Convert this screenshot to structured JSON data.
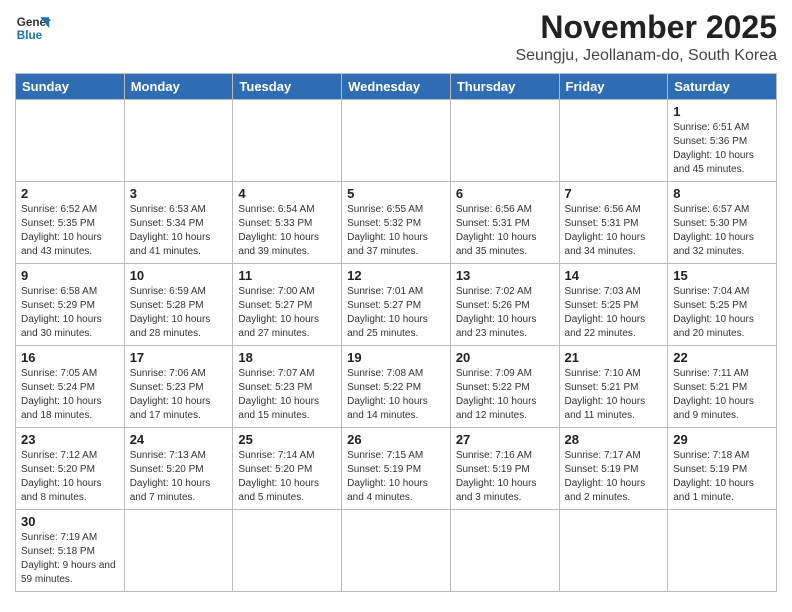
{
  "header": {
    "logo_line1": "General",
    "logo_line2": "Blue",
    "month": "November 2025",
    "location": "Seungju, Jeollanam-do, South Korea"
  },
  "days_of_week": [
    "Sunday",
    "Monday",
    "Tuesday",
    "Wednesday",
    "Thursday",
    "Friday",
    "Saturday"
  ],
  "weeks": [
    [
      {
        "day": "",
        "info": ""
      },
      {
        "day": "",
        "info": ""
      },
      {
        "day": "",
        "info": ""
      },
      {
        "day": "",
        "info": ""
      },
      {
        "day": "",
        "info": ""
      },
      {
        "day": "",
        "info": ""
      },
      {
        "day": "1",
        "info": "Sunrise: 6:51 AM\nSunset: 5:36 PM\nDaylight: 10 hours and 45 minutes."
      }
    ],
    [
      {
        "day": "2",
        "info": "Sunrise: 6:52 AM\nSunset: 5:35 PM\nDaylight: 10 hours and 43 minutes."
      },
      {
        "day": "3",
        "info": "Sunrise: 6:53 AM\nSunset: 5:34 PM\nDaylight: 10 hours and 41 minutes."
      },
      {
        "day": "4",
        "info": "Sunrise: 6:54 AM\nSunset: 5:33 PM\nDaylight: 10 hours and 39 minutes."
      },
      {
        "day": "5",
        "info": "Sunrise: 6:55 AM\nSunset: 5:32 PM\nDaylight: 10 hours and 37 minutes."
      },
      {
        "day": "6",
        "info": "Sunrise: 6:56 AM\nSunset: 5:31 PM\nDaylight: 10 hours and 35 minutes."
      },
      {
        "day": "7",
        "info": "Sunrise: 6:56 AM\nSunset: 5:31 PM\nDaylight: 10 hours and 34 minutes."
      },
      {
        "day": "8",
        "info": "Sunrise: 6:57 AM\nSunset: 5:30 PM\nDaylight: 10 hours and 32 minutes."
      }
    ],
    [
      {
        "day": "9",
        "info": "Sunrise: 6:58 AM\nSunset: 5:29 PM\nDaylight: 10 hours and 30 minutes."
      },
      {
        "day": "10",
        "info": "Sunrise: 6:59 AM\nSunset: 5:28 PM\nDaylight: 10 hours and 28 minutes."
      },
      {
        "day": "11",
        "info": "Sunrise: 7:00 AM\nSunset: 5:27 PM\nDaylight: 10 hours and 27 minutes."
      },
      {
        "day": "12",
        "info": "Sunrise: 7:01 AM\nSunset: 5:27 PM\nDaylight: 10 hours and 25 minutes."
      },
      {
        "day": "13",
        "info": "Sunrise: 7:02 AM\nSunset: 5:26 PM\nDaylight: 10 hours and 23 minutes."
      },
      {
        "day": "14",
        "info": "Sunrise: 7:03 AM\nSunset: 5:25 PM\nDaylight: 10 hours and 22 minutes."
      },
      {
        "day": "15",
        "info": "Sunrise: 7:04 AM\nSunset: 5:25 PM\nDaylight: 10 hours and 20 minutes."
      }
    ],
    [
      {
        "day": "16",
        "info": "Sunrise: 7:05 AM\nSunset: 5:24 PM\nDaylight: 10 hours and 18 minutes."
      },
      {
        "day": "17",
        "info": "Sunrise: 7:06 AM\nSunset: 5:23 PM\nDaylight: 10 hours and 17 minutes."
      },
      {
        "day": "18",
        "info": "Sunrise: 7:07 AM\nSunset: 5:23 PM\nDaylight: 10 hours and 15 minutes."
      },
      {
        "day": "19",
        "info": "Sunrise: 7:08 AM\nSunset: 5:22 PM\nDaylight: 10 hours and 14 minutes."
      },
      {
        "day": "20",
        "info": "Sunrise: 7:09 AM\nSunset: 5:22 PM\nDaylight: 10 hours and 12 minutes."
      },
      {
        "day": "21",
        "info": "Sunrise: 7:10 AM\nSunset: 5:21 PM\nDaylight: 10 hours and 11 minutes."
      },
      {
        "day": "22",
        "info": "Sunrise: 7:11 AM\nSunset: 5:21 PM\nDaylight: 10 hours and 9 minutes."
      }
    ],
    [
      {
        "day": "23",
        "info": "Sunrise: 7:12 AM\nSunset: 5:20 PM\nDaylight: 10 hours and 8 minutes."
      },
      {
        "day": "24",
        "info": "Sunrise: 7:13 AM\nSunset: 5:20 PM\nDaylight: 10 hours and 7 minutes."
      },
      {
        "day": "25",
        "info": "Sunrise: 7:14 AM\nSunset: 5:20 PM\nDaylight: 10 hours and 5 minutes."
      },
      {
        "day": "26",
        "info": "Sunrise: 7:15 AM\nSunset: 5:19 PM\nDaylight: 10 hours and 4 minutes."
      },
      {
        "day": "27",
        "info": "Sunrise: 7:16 AM\nSunset: 5:19 PM\nDaylight: 10 hours and 3 minutes."
      },
      {
        "day": "28",
        "info": "Sunrise: 7:17 AM\nSunset: 5:19 PM\nDaylight: 10 hours and 2 minutes."
      },
      {
        "day": "29",
        "info": "Sunrise: 7:18 AM\nSunset: 5:19 PM\nDaylight: 10 hours and 1 minute."
      }
    ],
    [
      {
        "day": "30",
        "info": "Sunrise: 7:19 AM\nSunset: 5:18 PM\nDaylight: 9 hours and 59 minutes."
      },
      {
        "day": "",
        "info": ""
      },
      {
        "day": "",
        "info": ""
      },
      {
        "day": "",
        "info": ""
      },
      {
        "day": "",
        "info": ""
      },
      {
        "day": "",
        "info": ""
      },
      {
        "day": "",
        "info": ""
      }
    ]
  ]
}
